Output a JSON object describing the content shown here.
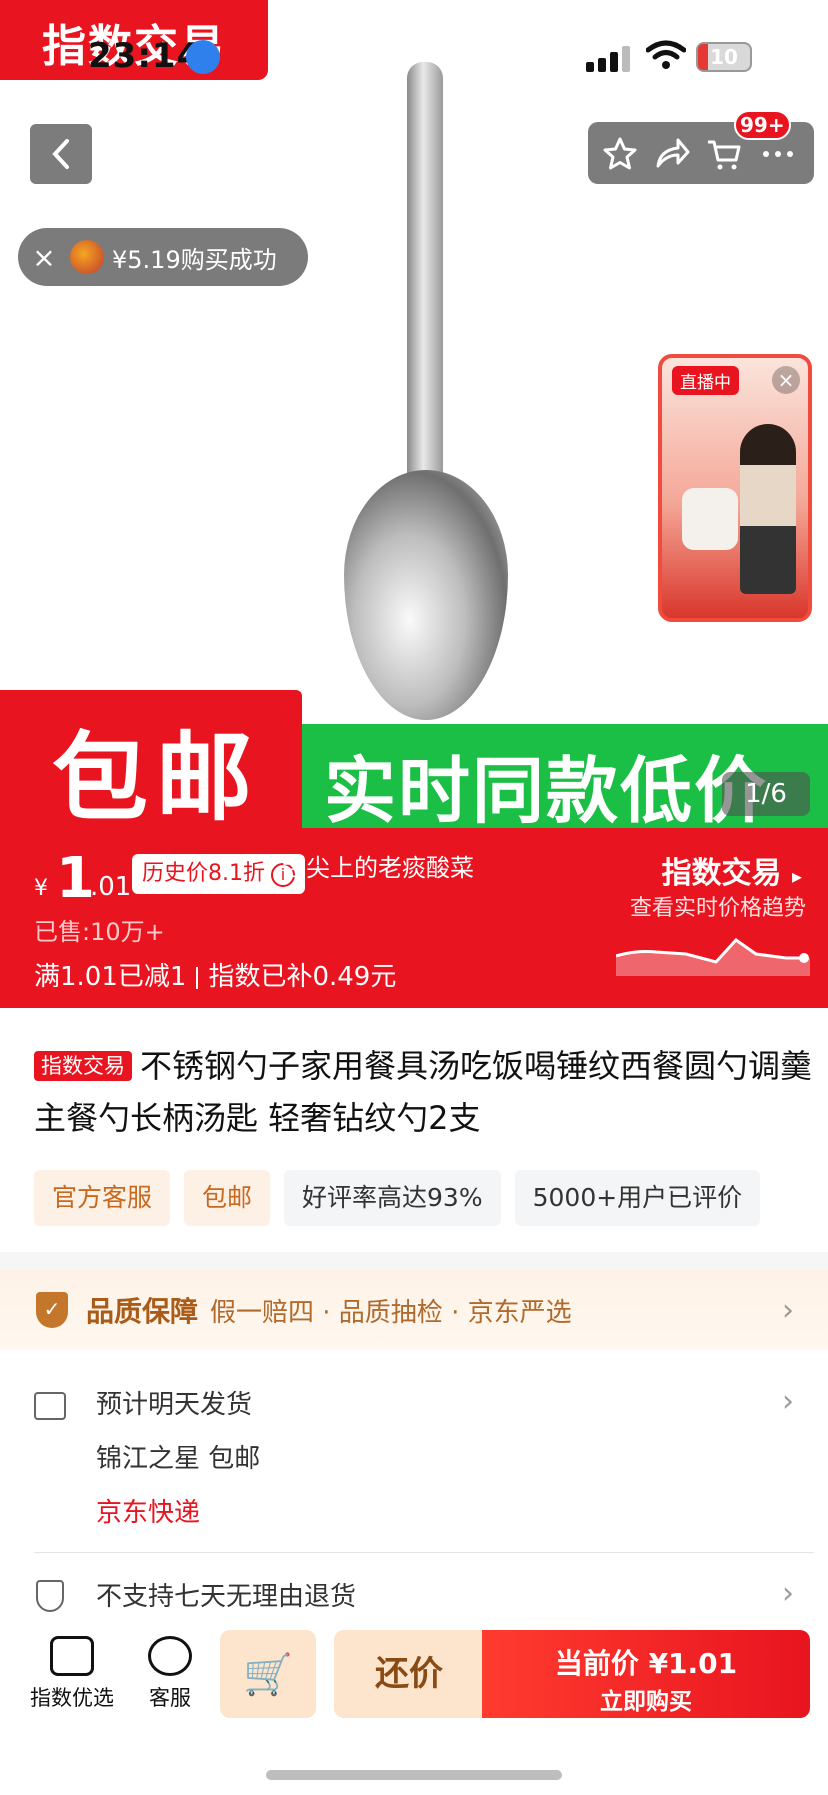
{
  "status_bar": {
    "time": "23:14",
    "battery": "10"
  },
  "hero": {
    "corner_badge": "指数交易",
    "cart_count": "99+",
    "toast": {
      "text": "¥5.19购买成功"
    },
    "live": {
      "tag": "直播中"
    },
    "banner_left": "包邮",
    "banner_right": "实时同款低价",
    "page_indicator": "1/6"
  },
  "price": {
    "currency": "¥",
    "integer": "1",
    "decimal": ".01",
    "history_badge": "历史价8.1折",
    "overlay_text": "舌尖上的老痰酸菜",
    "sold": "已售:10万+",
    "discount_left": "满1.01已减1",
    "discount_right": "指数已补0.49元",
    "index_link": "指数交易",
    "index_sub": "查看实时价格趋势"
  },
  "product": {
    "tag": "指数交易",
    "title": "不锈钢勺子家用餐具汤吃饭喝锤纹西餐圆勺调羹主餐勺长柄汤匙 轻奢钻纹勺2支",
    "chips": [
      "官方客服",
      "包邮",
      "好评率高达93%",
      "5000+用户已评价"
    ]
  },
  "quality": {
    "title": "品质保障",
    "items": "假一赔四 · 品质抽检 · 京东严选"
  },
  "shipping": {
    "eta": "预计明天发货",
    "store": "锦江之星  包邮",
    "courier": "京东快递"
  },
  "returns": {
    "text": "不支持七天无理由退货"
  },
  "bottom_bar": {
    "home_label": "指数优选",
    "service_label": "客服",
    "bargain_label": "还价",
    "buy_line1": "当前价 ¥1.01",
    "buy_line2": "立即购买"
  },
  "colors": {
    "brand_red": "#e8141f",
    "green": "#1bbf45",
    "orange_text": "#a95b17"
  }
}
